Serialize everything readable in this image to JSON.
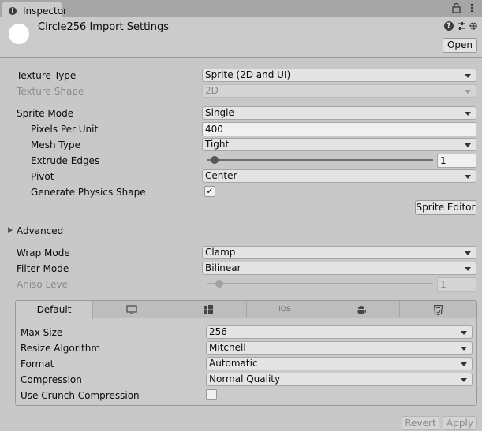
{
  "window": {
    "tab_label": "Inspector",
    "tab_icon": "info-icon",
    "lock_icon": "lock-icon",
    "menu_icon": "kebab-menu-icon"
  },
  "header": {
    "title": "Circle256 Import Settings",
    "open_label": "Open",
    "help_icon_glyph": "?",
    "icons": [
      "help-icon",
      "preset-icon",
      "settings-icon"
    ]
  },
  "texture": {
    "type_label": "Texture Type",
    "type_value": "Sprite (2D and UI)",
    "shape_label": "Texture Shape",
    "shape_value": "2D"
  },
  "sprite": {
    "mode_label": "Sprite Mode",
    "mode_value": "Single",
    "ppu_label": "Pixels Per Unit",
    "ppu_value": "400",
    "mesh_label": "Mesh Type",
    "mesh_value": "Tight",
    "extrude_label": "Extrude Edges",
    "extrude_value": "1",
    "extrude_slider_fraction": 0.03,
    "pivot_label": "Pivot",
    "pivot_value": "Center",
    "physics_label": "Generate Physics Shape",
    "physics_checked": true,
    "check_glyph": "✓",
    "editor_button": "Sprite Editor"
  },
  "advanced": {
    "label": "Advanced"
  },
  "wrap": {
    "wrap_label": "Wrap Mode",
    "wrap_value": "Clamp",
    "filter_label": "Filter Mode",
    "filter_value": "Bilinear",
    "aniso_label": "Aniso Level",
    "aniso_value": "1",
    "aniso_slider_fraction": 0.0
  },
  "platform": {
    "tabs": [
      {
        "label": "Default",
        "icon": ""
      },
      {
        "label": "",
        "icon": "monitor-icon"
      },
      {
        "label": "",
        "icon": "windows-icon"
      },
      {
        "label": "iOS",
        "icon": ""
      },
      {
        "label": "",
        "icon": "android-icon"
      },
      {
        "label": "",
        "icon": "html5-icon"
      }
    ],
    "max_size_label": "Max Size",
    "max_size_value": "256",
    "resize_label": "Resize Algorithm",
    "resize_value": "Mitchell",
    "format_label": "Format",
    "format_value": "Automatic",
    "compression_label": "Compression",
    "compression_value": "Normal Quality",
    "crunch_label": "Use Crunch Compression",
    "crunch_checked": false
  },
  "footer": {
    "revert_label": "Revert",
    "apply_label": "Apply"
  }
}
